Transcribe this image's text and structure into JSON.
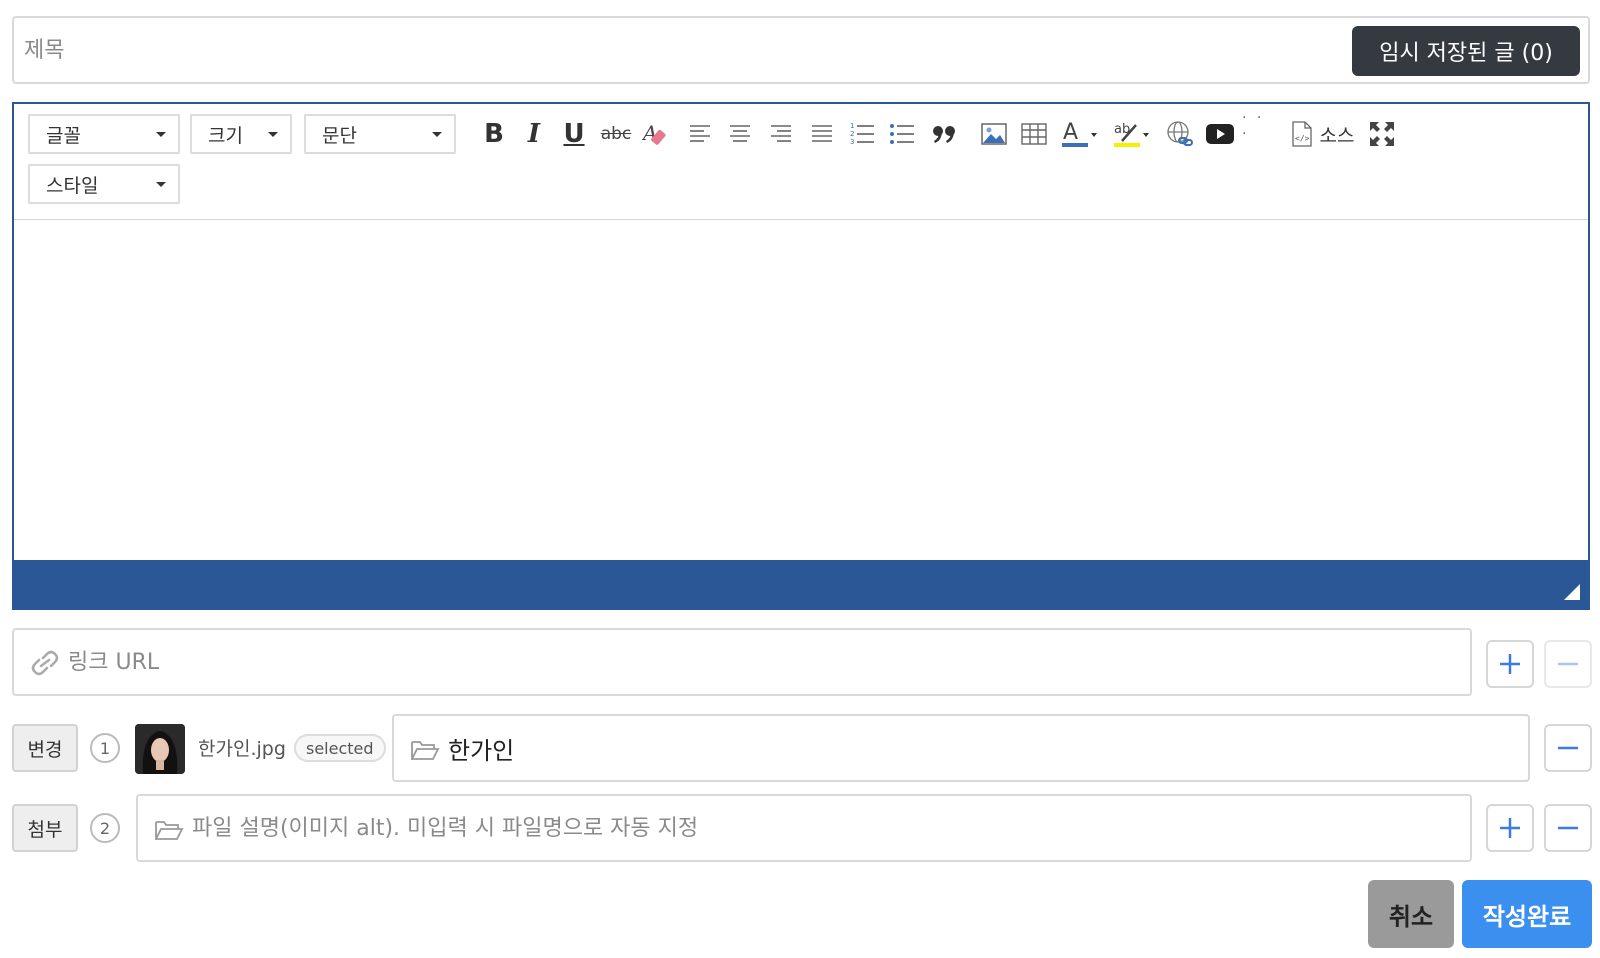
{
  "title": {
    "placeholder": "제목",
    "temp_saved_button": "임시 저장된 글 (0)"
  },
  "toolbar": {
    "font_select": "글꼴",
    "size_select": "크기",
    "paragraph_select": "문단",
    "style_select": "스타일",
    "bold": "B",
    "italic": "I",
    "underline": "U",
    "strike": "abc",
    "source_label": "소스",
    "icons": [
      "bold-icon",
      "italic-icon",
      "underline-icon",
      "strikethrough-icon",
      "remove-format-icon",
      "align-left-icon",
      "align-center-icon",
      "align-right-icon",
      "align-justify-icon",
      "numbered-list-icon",
      "bulleted-list-icon",
      "blockquote-icon",
      "image-icon",
      "table-icon",
      "text-color-icon",
      "background-color-icon",
      "link-icon",
      "video-icon",
      "more-icon",
      "source-icon",
      "maximize-icon"
    ]
  },
  "editor": {
    "accent_color": "#2b5797"
  },
  "link": {
    "placeholder": "링크 URL"
  },
  "files": [
    {
      "action_label": "변경",
      "index": "1",
      "filename": "한가인.jpg",
      "badge": "selected",
      "description": "한가인"
    },
    {
      "action_label": "첨부",
      "index": "2",
      "description_placeholder": "파일 설명(이미지 alt). 미입력 시 파일명으로 자동 지정"
    }
  ],
  "actions": {
    "cancel": "취소",
    "submit": "작성완료"
  },
  "colors": {
    "dark_button": "#343a40",
    "submit_blue": "#3b8fef",
    "cancel_gray": "#9a9a9a",
    "plus_blue": "#3b7ddd"
  }
}
